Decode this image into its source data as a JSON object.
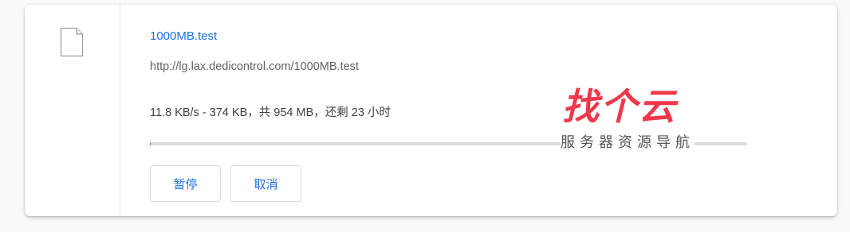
{
  "download": {
    "file_name": "1000MB.test",
    "url": "http://lg.lax.dedicontrol.com/1000MB.test",
    "status": "11.8 KB/s - 374 KB，共 954 MB，还剩 23 小时",
    "progress": 0.0004,
    "icon": "file-icon"
  },
  "buttons": {
    "pause_label": "暂停",
    "cancel_label": "取消"
  },
  "watermark": {
    "title": "找个云",
    "subtitle": "服务器资源导航"
  },
  "colors": {
    "accent": "#1a73e8",
    "track": "#dadce0",
    "watermark": "#f0384b"
  }
}
